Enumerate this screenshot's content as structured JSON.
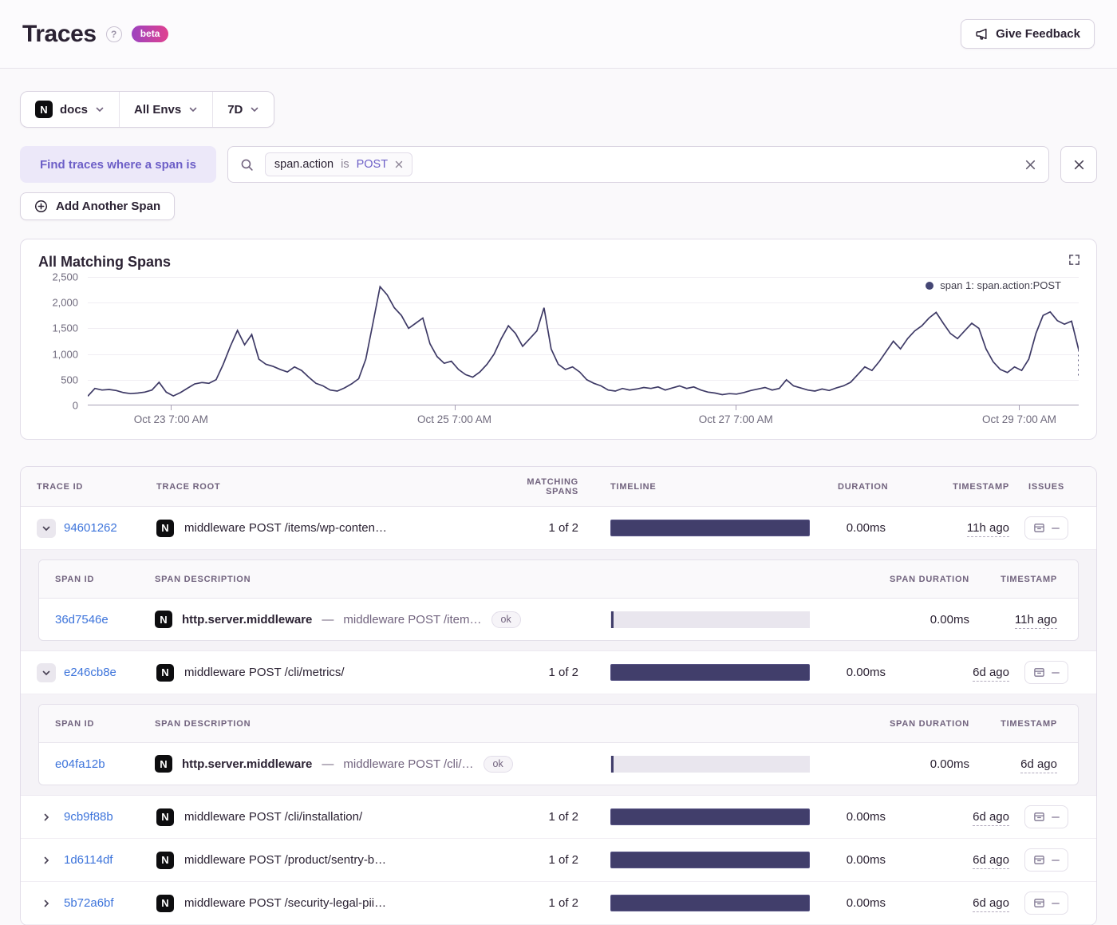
{
  "header": {
    "title": "Traces",
    "beta": "beta",
    "feedback": "Give Feedback"
  },
  "filters": {
    "project": "docs",
    "environment": "All Envs",
    "period": "7D"
  },
  "search": {
    "where_label": "Find traces where a span is",
    "token_key": "span.action",
    "token_op": "is",
    "token_value": "POST",
    "add_span": "Add Another Span"
  },
  "icons": {
    "help": "?",
    "project_letter": "N"
  },
  "chart_data": {
    "type": "line",
    "title": "All Matching Spans",
    "legend": [
      {
        "label": "span 1: span.action:POST",
        "color": "#444674"
      }
    ],
    "ylim": [
      0,
      2500
    ],
    "yticks_display": [
      "2,500",
      "2,000",
      "1,500",
      "1,000",
      "500",
      "0"
    ],
    "x_tick_labels": [
      "Oct 23 7:00 AM",
      "Oct 25 7:00 AM",
      "Oct 27 7:00 AM",
      "Oct 29 7:00 AM"
    ],
    "x_tick_positions_pct": [
      8.4,
      37.0,
      65.4,
      94.0
    ],
    "grid": "horizontal",
    "series": [
      {
        "name": "span 1: span.action:POST",
        "color": "#3E3A66",
        "values": [
          180,
          330,
          300,
          310,
          290,
          250,
          230,
          240,
          260,
          300,
          450,
          260,
          185,
          250,
          335,
          420,
          445,
          430,
          500,
          800,
          1150,
          1460,
          1180,
          1380,
          900,
          800,
          760,
          700,
          650,
          750,
          680,
          550,
          430,
          380,
          300,
          280,
          340,
          420,
          520,
          900,
          1600,
          2310,
          2150,
          1900,
          1750,
          1500,
          1600,
          1700,
          1200,
          950,
          820,
          860,
          700,
          600,
          550,
          650,
          800,
          1000,
          1300,
          1550,
          1400,
          1150,
          1300,
          1450,
          1900,
          1100,
          800,
          700,
          750,
          650,
          500,
          430,
          380,
          300,
          280,
          330,
          300,
          320,
          350,
          330,
          360,
          300,
          340,
          380,
          330,
          360,
          300,
          260,
          240,
          210,
          230,
          220,
          250,
          290,
          320,
          350,
          300,
          330,
          500,
          380,
          340,
          300,
          280,
          320,
          290,
          340,
          380,
          450,
          600,
          750,
          680,
          850,
          1050,
          1250,
          1100,
          1300,
          1450,
          1550,
          1700,
          1810,
          1600,
          1400,
          1300,
          1450,
          1600,
          1500,
          1100,
          850,
          700,
          640,
          750,
          680,
          900,
          1400,
          1750,
          1820,
          1650,
          1580,
          1640,
          1080
        ]
      }
    ],
    "dotted_tail_value": 560
  },
  "table": {
    "headers": {
      "trace_id": "TRACE ID",
      "trace_root": "TRACE ROOT",
      "matching": "MATCHING SPANS",
      "timeline": "TIMELINE",
      "duration": "DURATION",
      "timestamp": "TIMESTAMP",
      "issues": "ISSUES"
    },
    "span_headers": {
      "span_id": "SPAN ID",
      "description": "SPAN DESCRIPTION",
      "duration": "SPAN DURATION",
      "timestamp": "TIMESTAMP"
    },
    "rows": [
      {
        "trace_id": "94601262",
        "root": "middleware POST /items/wp-conten…",
        "matching": "1 of 2",
        "duration": "0.00ms",
        "timestamp": "11h ago",
        "expanded": true,
        "spans": [
          {
            "span_id": "36d7546e",
            "op": "http.server.middleware",
            "separator": "—",
            "description": "middleware POST /item…",
            "status": "ok",
            "duration": "0.00ms",
            "timestamp": "11h ago"
          }
        ]
      },
      {
        "trace_id": "e246cb8e",
        "root": "middleware POST /cli/metrics/",
        "matching": "1 of 2",
        "duration": "0.00ms",
        "timestamp": "6d ago",
        "expanded": true,
        "spans": [
          {
            "span_id": "e04fa12b",
            "op": "http.server.middleware",
            "separator": "—",
            "description": "middleware POST /cli/…",
            "status": "ok",
            "duration": "0.00ms",
            "timestamp": "6d ago"
          }
        ]
      },
      {
        "trace_id": "9cb9f88b",
        "root": "middleware POST /cli/installation/",
        "matching": "1 of 2",
        "duration": "0.00ms",
        "timestamp": "6d ago",
        "expanded": false
      },
      {
        "trace_id": "1d6114df",
        "root": "middleware POST /product/sentry-b…",
        "matching": "1 of 2",
        "duration": "0.00ms",
        "timestamp": "6d ago",
        "expanded": false
      },
      {
        "trace_id": "5b72a6bf",
        "root": "middleware POST /security-legal-pii…",
        "matching": "1 of 2",
        "duration": "0.00ms",
        "timestamp": "6d ago",
        "expanded": false
      }
    ]
  }
}
